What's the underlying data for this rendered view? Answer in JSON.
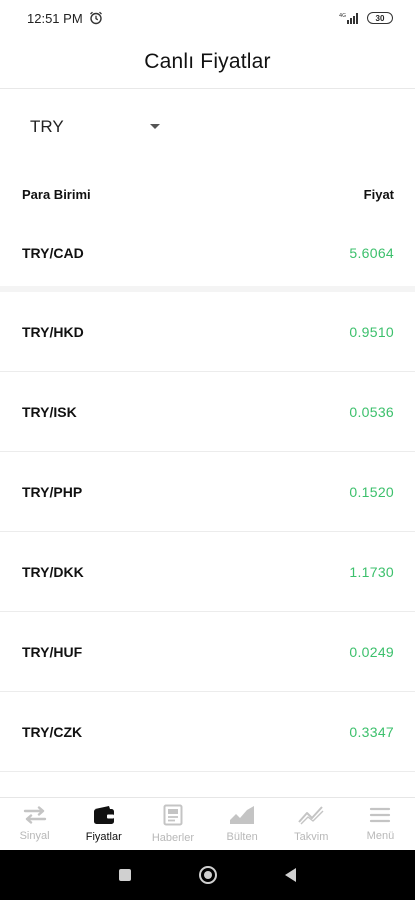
{
  "status_bar": {
    "time": "12:51 PM",
    "battery": "30"
  },
  "header": {
    "title": "Canlı Fiyatlar"
  },
  "currency_select": {
    "value": "TRY"
  },
  "table": {
    "col_currency": "Para Birimi",
    "col_price": "Fiyat",
    "rows": [
      {
        "pair": "TRY/CAD",
        "price": "5.6064"
      },
      {
        "pair": "TRY/HKD",
        "price": "0.9510"
      },
      {
        "pair": "TRY/ISK",
        "price": "0.0536"
      },
      {
        "pair": "TRY/PHP",
        "price": "0.1520"
      },
      {
        "pair": "TRY/DKK",
        "price": "1.1730"
      },
      {
        "pair": "TRY/HUF",
        "price": "0.0249"
      },
      {
        "pair": "TRY/CZK",
        "price": "0.3347"
      }
    ]
  },
  "tab_bar": {
    "items": [
      {
        "label": "Sinyal",
        "icon": "swap-arrows-icon",
        "active": false
      },
      {
        "label": "Fiyatlar",
        "icon": "wallet-icon",
        "active": true
      },
      {
        "label": "Haberler",
        "icon": "newspaper-icon",
        "active": false
      },
      {
        "label": "Bülten",
        "icon": "area-chart-icon",
        "active": false
      },
      {
        "label": "Takvim",
        "icon": "trend-line-icon",
        "active": false
      },
      {
        "label": "Menü",
        "icon": "hamburger-icon",
        "active": false
      }
    ]
  },
  "colors": {
    "price_green": "#3cc06c",
    "tab_inactive": "#b8b8b8",
    "tab_active": "#111111"
  }
}
